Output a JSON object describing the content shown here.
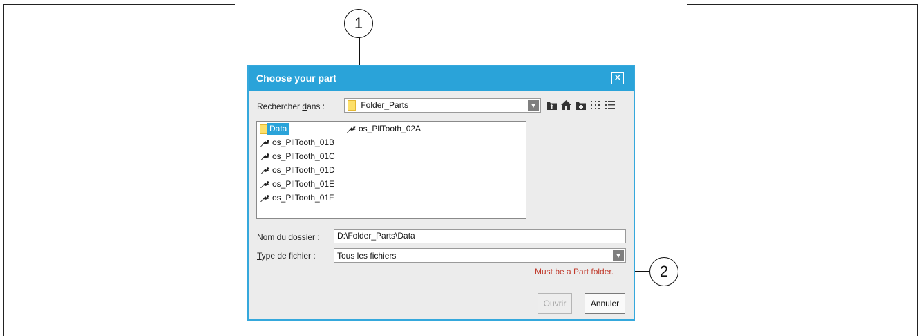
{
  "callouts": [
    {
      "number": "1"
    },
    {
      "number": "2"
    }
  ],
  "dialog": {
    "title": "Choose your part",
    "close_icon": "close-icon",
    "look_in": {
      "label_prefix": "Rechercher ",
      "label_mnemonic": "d",
      "label_suffix": "ans :",
      "value": "Folder_Parts"
    },
    "toolbar_icons": [
      "up-folder-icon",
      "home-icon",
      "new-folder-icon",
      "list-view-icon",
      "details-view-icon"
    ],
    "files": [
      {
        "name": "Data",
        "type": "folder",
        "selected": true
      },
      {
        "name": "os_PllTooth_01B",
        "type": "part"
      },
      {
        "name": "os_PllTooth_01C",
        "type": "part"
      },
      {
        "name": "os_PllTooth_01D",
        "type": "part"
      },
      {
        "name": "os_PllTooth_01E",
        "type": "part"
      },
      {
        "name": "os_PllTooth_01F",
        "type": "part"
      },
      {
        "name": "os_PllTooth_02A",
        "type": "part"
      }
    ],
    "folder_name": {
      "label_mnemonic": "N",
      "label_rest": "om du dossier :",
      "value": "D:\\Folder_Parts\\Data"
    },
    "file_type": {
      "label_mnemonic": "T",
      "label_rest": "ype de fichier :",
      "value": "Tous les fichiers"
    },
    "error_message": "Must be a Part folder.",
    "open_button": "Ouvrir",
    "cancel_button": "Annuler"
  }
}
